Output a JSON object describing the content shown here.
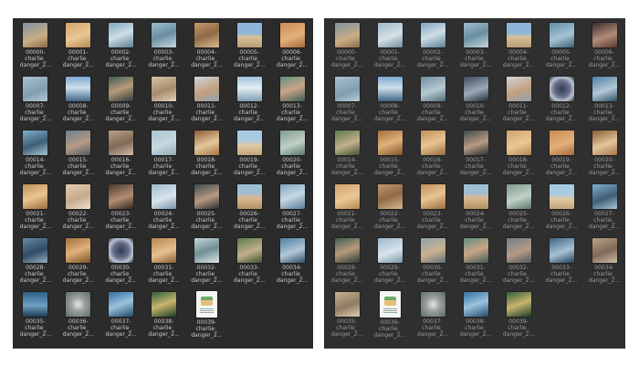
{
  "left_window": {
    "files": [
      {
        "line1": "00000-",
        "line2": "charlie_",
        "line3": "danger_2...",
        "swatch": "linear-gradient(160deg,#7e8fa0 0%,#c9ae84 60%,#8c6a48 100%)"
      },
      {
        "line1": "00001-",
        "line2": "charlie_",
        "line3": "danger_2...",
        "swatch": "linear-gradient(160deg,#d2a36c 0%,#e9c796 55%,#b7874f 100%)"
      },
      {
        "line1": "00002-",
        "line2": "charlie_",
        "line3": "danger_2...",
        "swatch": "linear-gradient(160deg,#7fa6bf 0%,#cfdde6 50%,#5a7f95 100%)"
      },
      {
        "line1": "00003-",
        "line2": "charlie_",
        "line3": "danger_2...",
        "swatch": "linear-gradient(160deg,#9fc0cf 0%,#6a8ea1 50%,#c8d7de 100%)"
      },
      {
        "line1": "00004-",
        "line2": "charlie_",
        "line3": "danger_2...",
        "swatch": "linear-gradient(160deg,#c4996a 0%,#8f6a47 50%,#dab98c 100%)"
      },
      {
        "line1": "00005-",
        "line2": "charlie_",
        "line3": "danger_2...",
        "swatch": "linear-gradient(180deg,#8fb6d8 0%,#8fb6d8 45%,#d8c29a 55%,#b99e75 100%)"
      },
      {
        "line1": "00006-",
        "line2": "charlie_",
        "line3": "danger_2...",
        "swatch": "linear-gradient(160deg,#c98b52 0%,#e4b07a 55%,#a4683b 100%)"
      },
      {
        "line1": "00007-",
        "line2": "charlie_",
        "line3": "danger_2...",
        "swatch": "linear-gradient(160deg,#a9c2cf 0%,#7f9eb0 60%,#b9cbd4 100%)"
      },
      {
        "line1": "00008-",
        "line2": "charlie_",
        "line3": "danger_2...",
        "swatch": "linear-gradient(180deg,#7aa7cf 0%,#cfe0ec 45%,#3f6685 100%)"
      },
      {
        "line1": "00009-",
        "line2": "charlie_",
        "line3": "danger_2...",
        "swatch": "linear-gradient(160deg,#3d5f52 0%,#b79a7c 50%,#2d3a36 100%)"
      },
      {
        "line1": "00010-",
        "line2": "charlie_",
        "line3": "danger_2...",
        "swatch": "linear-gradient(160deg,#d7c3a5 0%,#a78b6d 55%,#e3d3bb 100%)"
      },
      {
        "line1": "00011-",
        "line2": "charlie_",
        "line3": "danger_2...",
        "swatch": "linear-gradient(160deg,#cfd8de 0%,#c4a07d 55%,#8fa3b0 100%)"
      },
      {
        "line1": "00012-",
        "line2": "charlie_",
        "line3": "danger_2...",
        "swatch": "linear-gradient(180deg,#9cc2dc 0%,#e3eef4 45%,#7f9db2 100%)"
      },
      {
        "line1": "00013-",
        "line2": "charlie_",
        "line3": "danger_2...",
        "swatch": "linear-gradient(160deg,#5e8f7e 0%,#c9a487 50%,#3e5e53 100%)"
      },
      {
        "line1": "00014-",
        "line2": "charlie_",
        "line3": "danger_2...",
        "swatch": "linear-gradient(160deg,#7fb0cc 0%,#3f5e76 55%,#a8c6d6 100%)"
      },
      {
        "line1": "00015-",
        "line2": "charlie_",
        "line3": "danger_2...",
        "swatch": "linear-gradient(160deg,#6b7f8f 0%,#b79a85 55%,#4e5a63 100%)"
      },
      {
        "line1": "00016-",
        "line2": "charlie_",
        "line3": "danger_2...",
        "swatch": "linear-gradient(160deg,#b9a286 0%,#7e6a57 55%,#d1bea4 100%)"
      },
      {
        "line1": "00017-",
        "line2": "charlie_",
        "line3": "danger_2...",
        "swatch": "linear-gradient(160deg,#a8c4cf 0%,#c7d9df 55%,#8ea9b5 100%)"
      },
      {
        "line1": "00018-",
        "line2": "charlie_",
        "line3": "danger_2...",
        "swatch": "linear-gradient(160deg,#8c5b32 0%,#e2c79c 55%,#a97546 100%)"
      },
      {
        "line1": "00019-",
        "line2": "charlie_",
        "line3": "danger_2...",
        "swatch": "linear-gradient(180deg,#a8cbe2 0%,#a8cbe2 40%,#e0c9a3 60%,#c3a37a 100%)"
      },
      {
        "line1": "00020-",
        "line2": "charlie_",
        "line3": "danger_2...",
        "swatch": "linear-gradient(160deg,#7f9a8e 0%,#c0d1c7 55%,#5c7468 100%)"
      },
      {
        "line1": "00021-",
        "line2": "charlie_",
        "line3": "danger_2...",
        "swatch": "linear-gradient(160deg,#c18f5a 0%,#e7c591 50%,#9b6c3e 100%)"
      },
      {
        "line1": "00022-",
        "line2": "charlie_",
        "line3": "danger_2...",
        "swatch": "linear-gradient(160deg,#e1cbb0 0%,#c7ab8b 55%,#efe1cf 100%)"
      },
      {
        "line1": "00023-",
        "line2": "charlie_",
        "line3": "danger_2...",
        "swatch": "linear-gradient(160deg,#4a3b31 0%,#b38d72 55%,#2e2520 100%)"
      },
      {
        "line1": "00024-",
        "line2": "charlie_",
        "line3": "danger_2...",
        "swatch": "linear-gradient(160deg,#9bb7cc 0%,#d9e4eb 55%,#7894a8 100%)"
      },
      {
        "line1": "00025-",
        "line2": "charlie_",
        "line3": "danger_2...",
        "swatch": "linear-gradient(160deg,#3d4a4f 0%,#b89a82 55%,#262e31 100%)"
      },
      {
        "line1": "00026-",
        "line2": "charlie_",
        "line3": "danger_2...",
        "swatch": "linear-gradient(180deg,#9fbed4 0%,#9fbed4 35%,#d9b98d 55%,#b38f64 100%)"
      },
      {
        "line1": "00027-",
        "line2": "charlie_",
        "line3": "danger_2...",
        "swatch": "linear-gradient(160deg,#7fa8c4 0%,#c6d8e3 50%,#577d96 100%)"
      },
      {
        "line1": "00028-",
        "line2": "charlie_",
        "line3": "danger_2...",
        "swatch": "linear-gradient(160deg,#6a8aa8 0%,#2f4a63 55%,#95afc4 100%)"
      },
      {
        "line1": "00029-",
        "line2": "charlie_",
        "line3": "danger_2...",
        "swatch": "linear-gradient(160deg,#a36d3e 0%,#e0b27a 50%,#7e522c 100%)"
      },
      {
        "line1": "00030-",
        "line2": "charlie_",
        "line3": "danger_2...",
        "swatch": "radial-gradient(circle,#2e3c55 0%,#6a6f88 45%,#b8c3d4 70%,#2b2b2b 100%)"
      },
      {
        "line1": "00031-",
        "line2": "charlie_",
        "line3": "danger_2...",
        "swatch": "linear-gradient(160deg,#b98552 0%,#e6c18f 55%,#8c5f33 100%)"
      },
      {
        "line1": "00032-",
        "line2": "charlie_",
        "line3": "danger_2...",
        "swatch": "linear-gradient(160deg,#c9d9de 0%,#6f8f93 50%,#dce6e8 100%)"
      },
      {
        "line1": "00033-",
        "line2": "charlie_",
        "line3": "danger_2...",
        "swatch": "linear-gradient(160deg,#5c7a4d 0%,#c2b08b 55%,#3d5233 100%)"
      },
      {
        "line1": "00034-",
        "line2": "charlie_",
        "line3": "danger_2...",
        "swatch": "linear-gradient(160deg,#4d7fa3 0%,#b2c8d6 55%,#2f4f66 100%)"
      },
      {
        "line1": "00035-",
        "line2": "charlie_",
        "line3": "danger_2...",
        "swatch": "linear-gradient(180deg,#2e5f86 0%,#6f9fc1 55%,#1d3d57 100%)"
      },
      {
        "line1": "00036-",
        "line2": "charlie_",
        "line3": "danger_2...",
        "swatch": "radial-gradient(circle,#e8e8e8 0%,#9aa0a0 40%,#5b6a6a 100%)"
      },
      {
        "line1": "00037-",
        "line2": "charlie_",
        "line3": "danger_2...",
        "swatch": "linear-gradient(160deg,#2f6fa1 0%,#9cc3dd 50%,#1f4a6b 100%)"
      },
      {
        "line1": "00038-",
        "line2": "charlie_",
        "line3": "danger_2...",
        "swatch": "linear-gradient(160deg,#2c5f3a 0%,#c9b46d 50%,#1c3d26 100%)"
      },
      {
        "line1": "00039-",
        "line2": "charlie_",
        "line3": "danger_2...",
        "swatch": "doc"
      }
    ]
  },
  "right_window": {
    "files": [
      {
        "line1": "00000-",
        "line2": "charlie_",
        "line3": "danger_2...",
        "swatch": "linear-gradient(160deg,#7e8fa0 0%,#c9ae84 60%,#8c6a48 100%)"
      },
      {
        "line1": "00001-",
        "line2": "charlie_",
        "line3": "danger_2...",
        "swatch": "linear-gradient(160deg,#9fb9c9 0%,#d6e1e7 55%,#6f8b9c 100%)"
      },
      {
        "line1": "00002-",
        "line2": "charlie_",
        "line3": "danger_2...",
        "swatch": "linear-gradient(160deg,#7fa6bf 0%,#cfdde6 50%,#5a7f95 100%)"
      },
      {
        "line1": "00003-",
        "line2": "charlie_",
        "line3": "danger_2...",
        "swatch": "linear-gradient(160deg,#9fc0cf 0%,#6a8ea1 50%,#c8d7de 100%)"
      },
      {
        "line1": "00004-",
        "line2": "charlie_",
        "line3": "danger_2...",
        "swatch": "linear-gradient(180deg,#8fb6d8 0%,#8fb6d8 45%,#d8c29a 55%,#b99e75 100%)"
      },
      {
        "line1": "00005-",
        "line2": "charlie_",
        "line3": "danger_2...",
        "swatch": "linear-gradient(160deg,#5f8ea6 0%,#a5c3d2 55%,#3e6075 100%)"
      },
      {
        "line1": "00006-",
        "line2": "charlie_",
        "line3": "danger_2...",
        "swatch": "linear-gradient(160deg,#3a2c28 0%,#b08b7a 55%,#5d3a33 100%)"
      },
      {
        "line1": "00007-",
        "line2": "charlie_",
        "line3": "danger_2...",
        "swatch": "linear-gradient(160deg,#a9c2cf 0%,#7f9eb0 60%,#b9cbd4 100%)"
      },
      {
        "line1": "00008-",
        "line2": "charlie_",
        "line3": "danger_2...",
        "swatch": "linear-gradient(180deg,#7aa7cf 0%,#cfe0ec 45%,#3f6685 100%)"
      },
      {
        "line1": "00009-",
        "line2": "charlie_",
        "line3": "danger_2...",
        "swatch": "linear-gradient(160deg,#6f8fa0 0%,#b7c9d2 55%,#4f6b79 100%)"
      },
      {
        "line1": "00010-",
        "line2": "charlie_",
        "line3": "danger_2...",
        "swatch": "linear-gradient(160deg,#3d4a5c 0%,#9aa8b8 55%,#232c37 100%)"
      },
      {
        "line1": "00011-",
        "line2": "charlie_",
        "line3": "danger_2...",
        "swatch": "linear-gradient(160deg,#cfd8de 0%,#c4a07d 55%,#8fa3b0 100%)"
      },
      {
        "line1": "00012-",
        "line2": "charlie_",
        "line3": "danger_2...",
        "swatch": "radial-gradient(circle,#2e3c55 0%,#6a6f88 45%,#b8c3d4 70%,#2b2b2b 100%)"
      },
      {
        "line1": "00013-",
        "line2": "charlie_",
        "line3": "danger_2...",
        "swatch": "linear-gradient(160deg,#4d7fa3 0%,#b2c8d6 55%,#2f4f66 100%)"
      },
      {
        "line1": "00014-",
        "line2": "charlie_",
        "line3": "danger_2...",
        "swatch": "linear-gradient(160deg,#5c7a4d 0%,#c2b08b 55%,#3d5233 100%)"
      },
      {
        "line1": "00015-",
        "line2": "charlie_",
        "line3": "danger_2...",
        "swatch": "linear-gradient(160deg,#a36d3e 0%,#e0b27a 50%,#7e522c 100%)"
      },
      {
        "line1": "00016-",
        "line2": "charlie_",
        "line3": "danger_2...",
        "swatch": "linear-gradient(160deg,#c18f5a 0%,#e7c591 50%,#9b6c3e 100%)"
      },
      {
        "line1": "00017-",
        "line2": "charlie_",
        "line3": "danger_2...",
        "swatch": "linear-gradient(160deg,#3d4a4f 0%,#b89a82 55%,#262e31 100%)"
      },
      {
        "line1": "00018-",
        "line2": "charlie_",
        "line3": "danger_2...",
        "swatch": "linear-gradient(160deg,#d2a36c 0%,#e9c796 55%,#b7874f 100%)"
      },
      {
        "line1": "00019-",
        "line2": "charlie_",
        "line3": "danger_2...",
        "swatch": "linear-gradient(160deg,#c98b52 0%,#e4b07a 55%,#a4683b 100%)"
      },
      {
        "line1": "00020-",
        "line2": "charlie_",
        "line3": "danger_2...",
        "swatch": "linear-gradient(160deg,#8c5b32 0%,#e2c79c 55%,#a97546 100%)"
      },
      {
        "line1": "00021-",
        "line2": "charlie_",
        "line3": "danger_2...",
        "swatch": "linear-gradient(160deg,#d2a36c 0%,#e9c796 55%,#b7874f 100%)"
      },
      {
        "line1": "00022-",
        "line2": "charlie_",
        "line3": "danger_2...",
        "swatch": "linear-gradient(160deg,#c4996a 0%,#8f6a47 50%,#dab98c 100%)"
      },
      {
        "line1": "00023-",
        "line2": "charlie_",
        "line3": "danger_2...",
        "swatch": "linear-gradient(160deg,#c18f5a 0%,#e7c591 50%,#9b6c3e 100%)"
      },
      {
        "line1": "00024-",
        "line2": "charlie_",
        "line3": "danger_2...",
        "swatch": "linear-gradient(180deg,#9fbed4 0%,#9fbed4 35%,#d9b98d 55%,#b38f64 100%)"
      },
      {
        "line1": "00025-",
        "line2": "charlie_",
        "line3": "danger_2...",
        "swatch": "linear-gradient(160deg,#7f9a8e 0%,#c0d1c7 55%,#5c7468 100%)"
      },
      {
        "line1": "00026-",
        "line2": "charlie_",
        "line3": "danger_2...",
        "swatch": "linear-gradient(180deg,#a8cbe2 0%,#a8cbe2 40%,#e0c9a3 60%,#c3a37a 100%)"
      },
      {
        "line1": "00027-",
        "line2": "charlie_",
        "line3": "danger_2...",
        "swatch": "linear-gradient(160deg,#7fb0cc 0%,#3f5e76 55%,#a8c6d6 100%)"
      },
      {
        "line1": "00028-",
        "line2": "charlie_",
        "line3": "danger_2...",
        "swatch": "linear-gradient(160deg,#3d5f52 0%,#b79a7c 50%,#2d3a36 100%)"
      },
      {
        "line1": "00029-",
        "line2": "charlie_",
        "line3": "danger_2...",
        "swatch": "linear-gradient(160deg,#9bb7cc 0%,#d9e4eb 55%,#7894a8 100%)"
      },
      {
        "line1": "00030-",
        "line2": "charlie_",
        "line3": "danger_2...",
        "swatch": "linear-gradient(160deg,#8fa3b0 0%,#c9b18f 55%,#5d6f7a 100%)"
      },
      {
        "line1": "00031-",
        "line2": "charlie_",
        "line3": "danger_2...",
        "swatch": "linear-gradient(160deg,#5e8f7e 0%,#c9a487 50%,#3e5e53 100%)"
      },
      {
        "line1": "00032-",
        "line2": "charlie_",
        "line3": "danger_2...",
        "swatch": "linear-gradient(160deg,#6b7f8f 0%,#b79a85 55%,#4e5a63 100%)"
      },
      {
        "line1": "00033-",
        "line2": "charlie_",
        "line3": "danger_2...",
        "swatch": "linear-gradient(160deg,#3f6685 0%,#a7c2d6 55%,#25415a 100%)"
      },
      {
        "line1": "00034-",
        "line2": "charlie_",
        "line3": "danger_2...",
        "swatch": "linear-gradient(160deg,#b9a286 0%,#7e6a57 55%,#d1bea4 100%)"
      },
      {
        "line1": "00035-",
        "line2": "charlie_",
        "line3": "danger_2...",
        "swatch": "linear-gradient(160deg,#c6b08e 0%,#8f7b62 55%,#e0d0b6 100%)"
      },
      {
        "line1": "00036-",
        "line2": "charlie_",
        "line3": "danger_2...",
        "swatch": "doc"
      },
      {
        "line1": "00037-",
        "line2": "charlie_",
        "line3": "danger_2...",
        "swatch": "radial-gradient(circle,#e8e8e8 0%,#9aa0a0 40%,#5b6a6a 100%)"
      },
      {
        "line1": "00038-",
        "line2": "charlie_",
        "line3": "danger_2...",
        "swatch": "linear-gradient(160deg,#2f6fa1 0%,#9cc3dd 50%,#1f4a6b 100%)"
      },
      {
        "line1": "00039-",
        "line2": "charlie_",
        "line3": "danger_2...",
        "swatch": "linear-gradient(160deg,#2c5f3a 0%,#c9b46d 50%,#1c3d26 100%)"
      }
    ]
  }
}
